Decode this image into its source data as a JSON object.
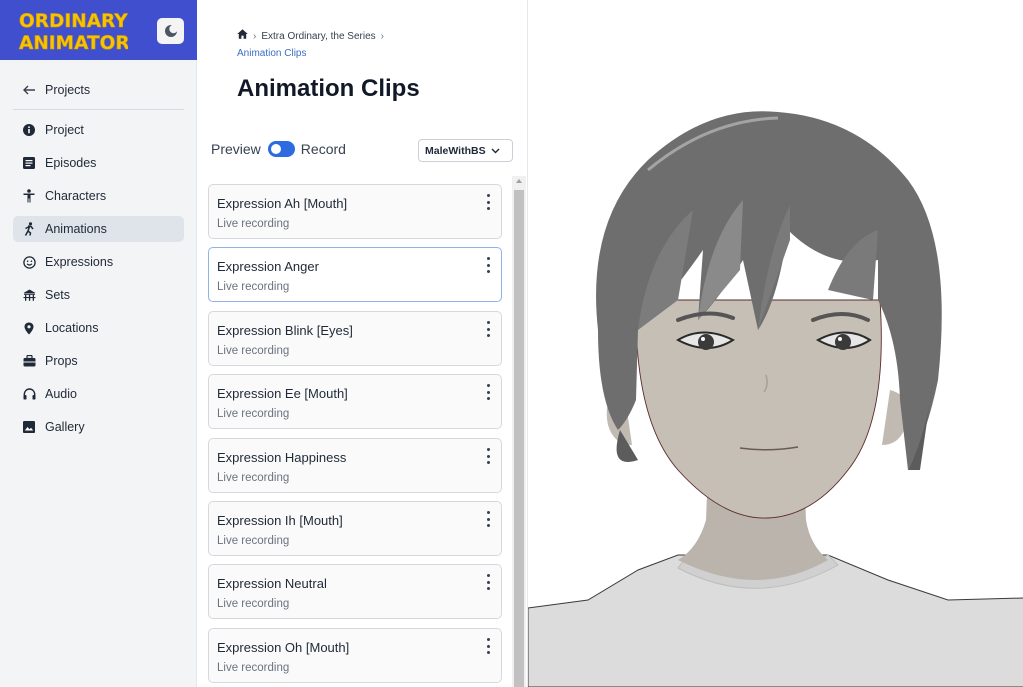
{
  "brand": {
    "line1": "ORDINARY",
    "line2": "ANIMATOR"
  },
  "nav": {
    "back_label": "Projects",
    "items": [
      {
        "label": "Project",
        "icon": "info-icon"
      },
      {
        "label": "Episodes",
        "icon": "list-icon"
      },
      {
        "label": "Characters",
        "icon": "person-icon"
      },
      {
        "label": "Animations",
        "icon": "running-icon",
        "active": true
      },
      {
        "label": "Expressions",
        "icon": "smiley-icon"
      },
      {
        "label": "Sets",
        "icon": "pavilion-icon"
      },
      {
        "label": "Locations",
        "icon": "pin-icon"
      },
      {
        "label": "Props",
        "icon": "briefcase-icon"
      },
      {
        "label": "Audio",
        "icon": "headphones-icon"
      },
      {
        "label": "Gallery",
        "icon": "image-icon"
      }
    ]
  },
  "breadcrumb": {
    "project": "Extra Ordinary, the Series",
    "current": "Animation Clips"
  },
  "page": {
    "title": "Animation Clips"
  },
  "mode": {
    "preview_label": "Preview",
    "record_label": "Record"
  },
  "character_select": {
    "value": "MaleWithBS"
  },
  "clips": [
    {
      "name": "Expression Ah [Mouth]",
      "status": "Live recording"
    },
    {
      "name": "Expression Anger",
      "status": "Live recording",
      "selected": true
    },
    {
      "name": "Expression Blink [Eyes]",
      "status": "Live recording"
    },
    {
      "name": "Expression Ee [Mouth]",
      "status": "Live recording"
    },
    {
      "name": "Expression Happiness",
      "status": "Live recording"
    },
    {
      "name": "Expression Ih [Mouth]",
      "status": "Live recording"
    },
    {
      "name": "Expression Neutral",
      "status": "Live recording"
    },
    {
      "name": "Expression Oh [Mouth]",
      "status": "Live recording"
    }
  ],
  "colors": {
    "brand_bg": "#3f4fce",
    "logo_yellow": "#f7c400",
    "accent": "#2f6be0"
  }
}
